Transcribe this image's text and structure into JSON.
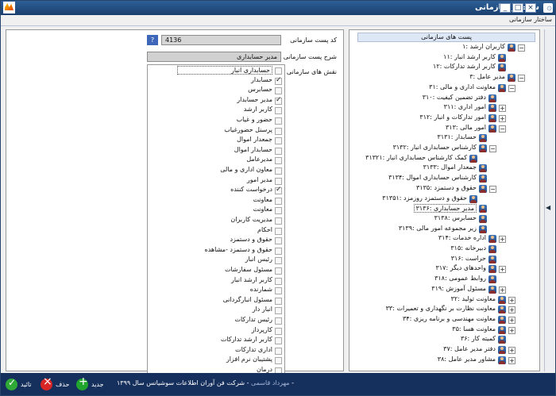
{
  "window": {
    "title": "ساختار سازمانی",
    "tab": "ساختار سازمانی",
    "buttons": {
      "minimize": "_",
      "maximize": "□",
      "close": "×"
    }
  },
  "form": {
    "post_code_label": "کد پست سازمانی",
    "post_code_value": "4136",
    "help_button": "?",
    "description_label": "شرح پست سازمانی",
    "description_value": "مدیر حسابداری",
    "roles_label": "نقش های سازمانی"
  },
  "roles": [
    {
      "label": "حسابداری انبار",
      "checked": false
    },
    {
      "label": "حسابدار",
      "checked": true
    },
    {
      "label": "حسابرس",
      "checked": false
    },
    {
      "label": "مدیر حسابدار",
      "checked": true
    },
    {
      "label": "کاربر ارشد",
      "checked": false
    },
    {
      "label": "حضور و غیاب",
      "checked": false
    },
    {
      "label": "پرسنل حضورغیاب",
      "checked": false
    },
    {
      "label": "جمعدار اموال",
      "checked": false
    },
    {
      "label": "حسابدار اموال",
      "checked": false
    },
    {
      "label": "مدیرعامل",
      "checked": false
    },
    {
      "label": "معاون اداری و مالی",
      "checked": false
    },
    {
      "label": "مدیر امور",
      "checked": false
    },
    {
      "label": "درخواست کننده",
      "checked": true
    },
    {
      "label": "معاونت",
      "checked": false
    },
    {
      "label": "معاونت",
      "checked": false
    },
    {
      "label": "مدیریت کاربران",
      "checked": false
    },
    {
      "label": "احکام",
      "checked": false
    },
    {
      "label": "حقوق و دستمزد",
      "checked": false
    },
    {
      "label": "حقوق و دستمزد -مشاهده",
      "checked": false
    },
    {
      "label": "رئیس انبار",
      "checked": false
    },
    {
      "label": "مسئول سفارشات",
      "checked": false
    },
    {
      "label": "کاربر ارشد انبار",
      "checked": false
    },
    {
      "label": "شمارنده",
      "checked": false
    },
    {
      "label": "مسئول انبارگردانی",
      "checked": false
    },
    {
      "label": "انبار دار",
      "checked": false
    },
    {
      "label": "رئیس تدارکات",
      "checked": false
    },
    {
      "label": "کارپرداز",
      "checked": false
    },
    {
      "label": "کاربر ارشد تدارکات",
      "checked": false
    },
    {
      "label": "اداری تدارکات",
      "checked": false
    },
    {
      "label": "پشتیبان نرم افزار",
      "checked": false
    },
    {
      "label": "درمان",
      "checked": false
    }
  ],
  "tree": {
    "header": "پست های سازمانی",
    "nodes": [
      {
        "label": "۱: کاربران ارشد",
        "toggle": "−"
      },
      {
        "label": "۱۱: کاربر ارشد انبار",
        "toggle": ""
      },
      {
        "label": "۱۲: کاربر ارشد تدارکات",
        "toggle": ""
      },
      {
        "label": "۳: مدیر عامل",
        "toggle": "−"
      },
      {
        "label": "۳۱: معاونت اداری و مالی",
        "toggle": "−"
      },
      {
        "label": "۳۱۰: دفتر تضمین کیفیت",
        "toggle": ""
      },
      {
        "label": "۳۱۱: امور اداری",
        "toggle": "+"
      },
      {
        "label": "۳۱۲: امور تدارکات و انبار",
        "toggle": "+"
      },
      {
        "label": "۳۱۳: امور مالی",
        "toggle": "−"
      },
      {
        "label": "۳۱۳۱: حسابدار",
        "toggle": ""
      },
      {
        "label": "۳۱۳۲: کارشناس حسابداری انبار",
        "toggle": "−"
      },
      {
        "label": "۳۱۳۲۱: کمک کارشناس حسابداری انبار",
        "toggle": ""
      },
      {
        "label": "۳۱۳۳: جمعدار اموال",
        "toggle": ""
      },
      {
        "label": "۳۱۳۴: کارشناس حسابداری اموال",
        "toggle": ""
      },
      {
        "label": "۳۱۳۵: حقوق و دستمزد",
        "toggle": "−"
      },
      {
        "label": "۳۱۳۵۱: حقوق و دستمزد روزمزد",
        "toggle": ""
      },
      {
        "label": "۳۱۳۶: مدیر حسابداری",
        "toggle": ""
      },
      {
        "label": "۳۱۳۸: حسابرس",
        "toggle": ""
      },
      {
        "label": "۳۱۳۹: زیر مجموعه امور مالی",
        "toggle": ""
      },
      {
        "label": "۳۱۴: اداره خدمات",
        "toggle": "+"
      },
      {
        "label": "۳۱۵: دبیرخانه",
        "toggle": ""
      },
      {
        "label": "۳۱۶: حراست",
        "toggle": ""
      },
      {
        "label": "۳۱۷: واحدهای دیگر",
        "toggle": "+"
      },
      {
        "label": "۳۱۸: روابط عمومی",
        "toggle": ""
      },
      {
        "label": "۳۱۹: مسئول آموزش",
        "toggle": "+"
      },
      {
        "label": "۳۲: معاونت تولید",
        "toggle": "+"
      },
      {
        "label": "۳۳: معاونت نظارت بر نگهداری و تعمیرات",
        "toggle": "+"
      },
      {
        "label": "۳۴: معاونت مهندسی و برنامه ریزی",
        "toggle": "+"
      },
      {
        "label": "۳۵: معاونت هسا",
        "toggle": "+"
      },
      {
        "label": "۳۶: کمیته کار",
        "toggle": ""
      },
      {
        "label": "۳۷: دفتر مدیر عامل",
        "toggle": "+"
      },
      {
        "label": "۳۸: مشاور مدیر عامل",
        "toggle": "+"
      }
    ]
  },
  "footer": {
    "company": "- شرکت فن آوران اطلاعات سوشیانس سال ۱۳۹۹ -",
    "user": "مهرداد قاسمی",
    "actions": {
      "new": "جدید",
      "delete": "حذف",
      "confirm": "تائید"
    }
  },
  "side_handle": "◀"
}
